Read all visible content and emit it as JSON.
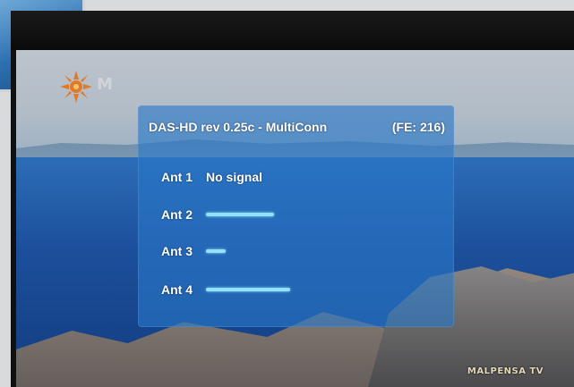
{
  "osd": {
    "title": "DAS-HD rev 0.25c - MultiConn",
    "frontend": "(FE: 216)",
    "antennas": [
      {
        "label": "Ant 1",
        "status": "No signal",
        "signal": 0
      },
      {
        "label": "Ant 2",
        "status": "",
        "signal": 0.38
      },
      {
        "label": "Ant 3",
        "status": "",
        "signal": 0.11
      },
      {
        "label": "Ant 4",
        "status": "",
        "signal": 0.47
      }
    ]
  },
  "channel": {
    "logo_letter": "M",
    "watermark": "MALPENSA TV"
  },
  "colors": {
    "signal_bar": "#8fe3ff",
    "osd_panel": "#2878c8"
  }
}
